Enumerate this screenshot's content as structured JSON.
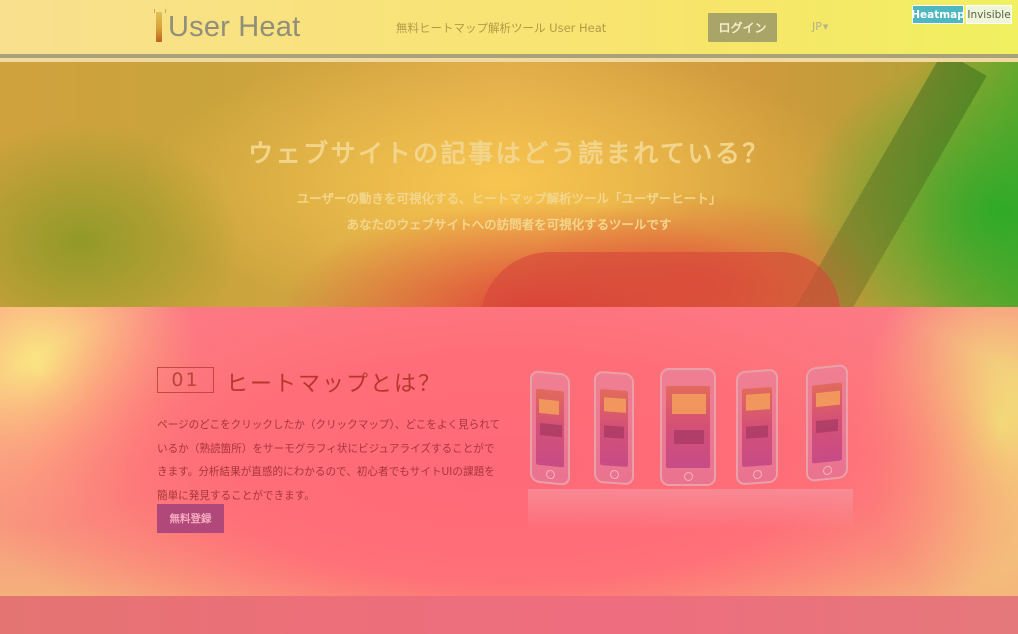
{
  "header": {
    "logo_text": "User Heat",
    "tagline": "無料ヒートマップ解析ツール User Heat",
    "login_label": "ログイン",
    "language": "JP"
  },
  "view_toggle": {
    "heatmap_label": "Heatmap",
    "invisible_label": "Invisible"
  },
  "hero": {
    "title": "ウェブサイトの記事はどう読まれている？",
    "subtitle_line1": "ユーザーの動きを可視化する、ヒートマップ解析ツール「ユーザーヒート」",
    "subtitle_line2": "あなたのウェブサイトへの訪問者を可視化するツールです"
  },
  "section": {
    "number": "01",
    "title": "ヒートマップとは？",
    "description": "ページのどこをクリックしたか（クリックマップ）、どこをよく見られているか（熟読箇所）をサーモグラフィ状にビジュアライズすることができます。分析結果が直感的にわかるので、初心者でもサイトUIの課題を簡単に発見することができます。",
    "signup_label": "無料登録"
  },
  "colors": {
    "heatmap_toggle": "#4fb7bf",
    "hot_red": "#ff6b7a",
    "warm_yellow": "#f5e46c"
  }
}
